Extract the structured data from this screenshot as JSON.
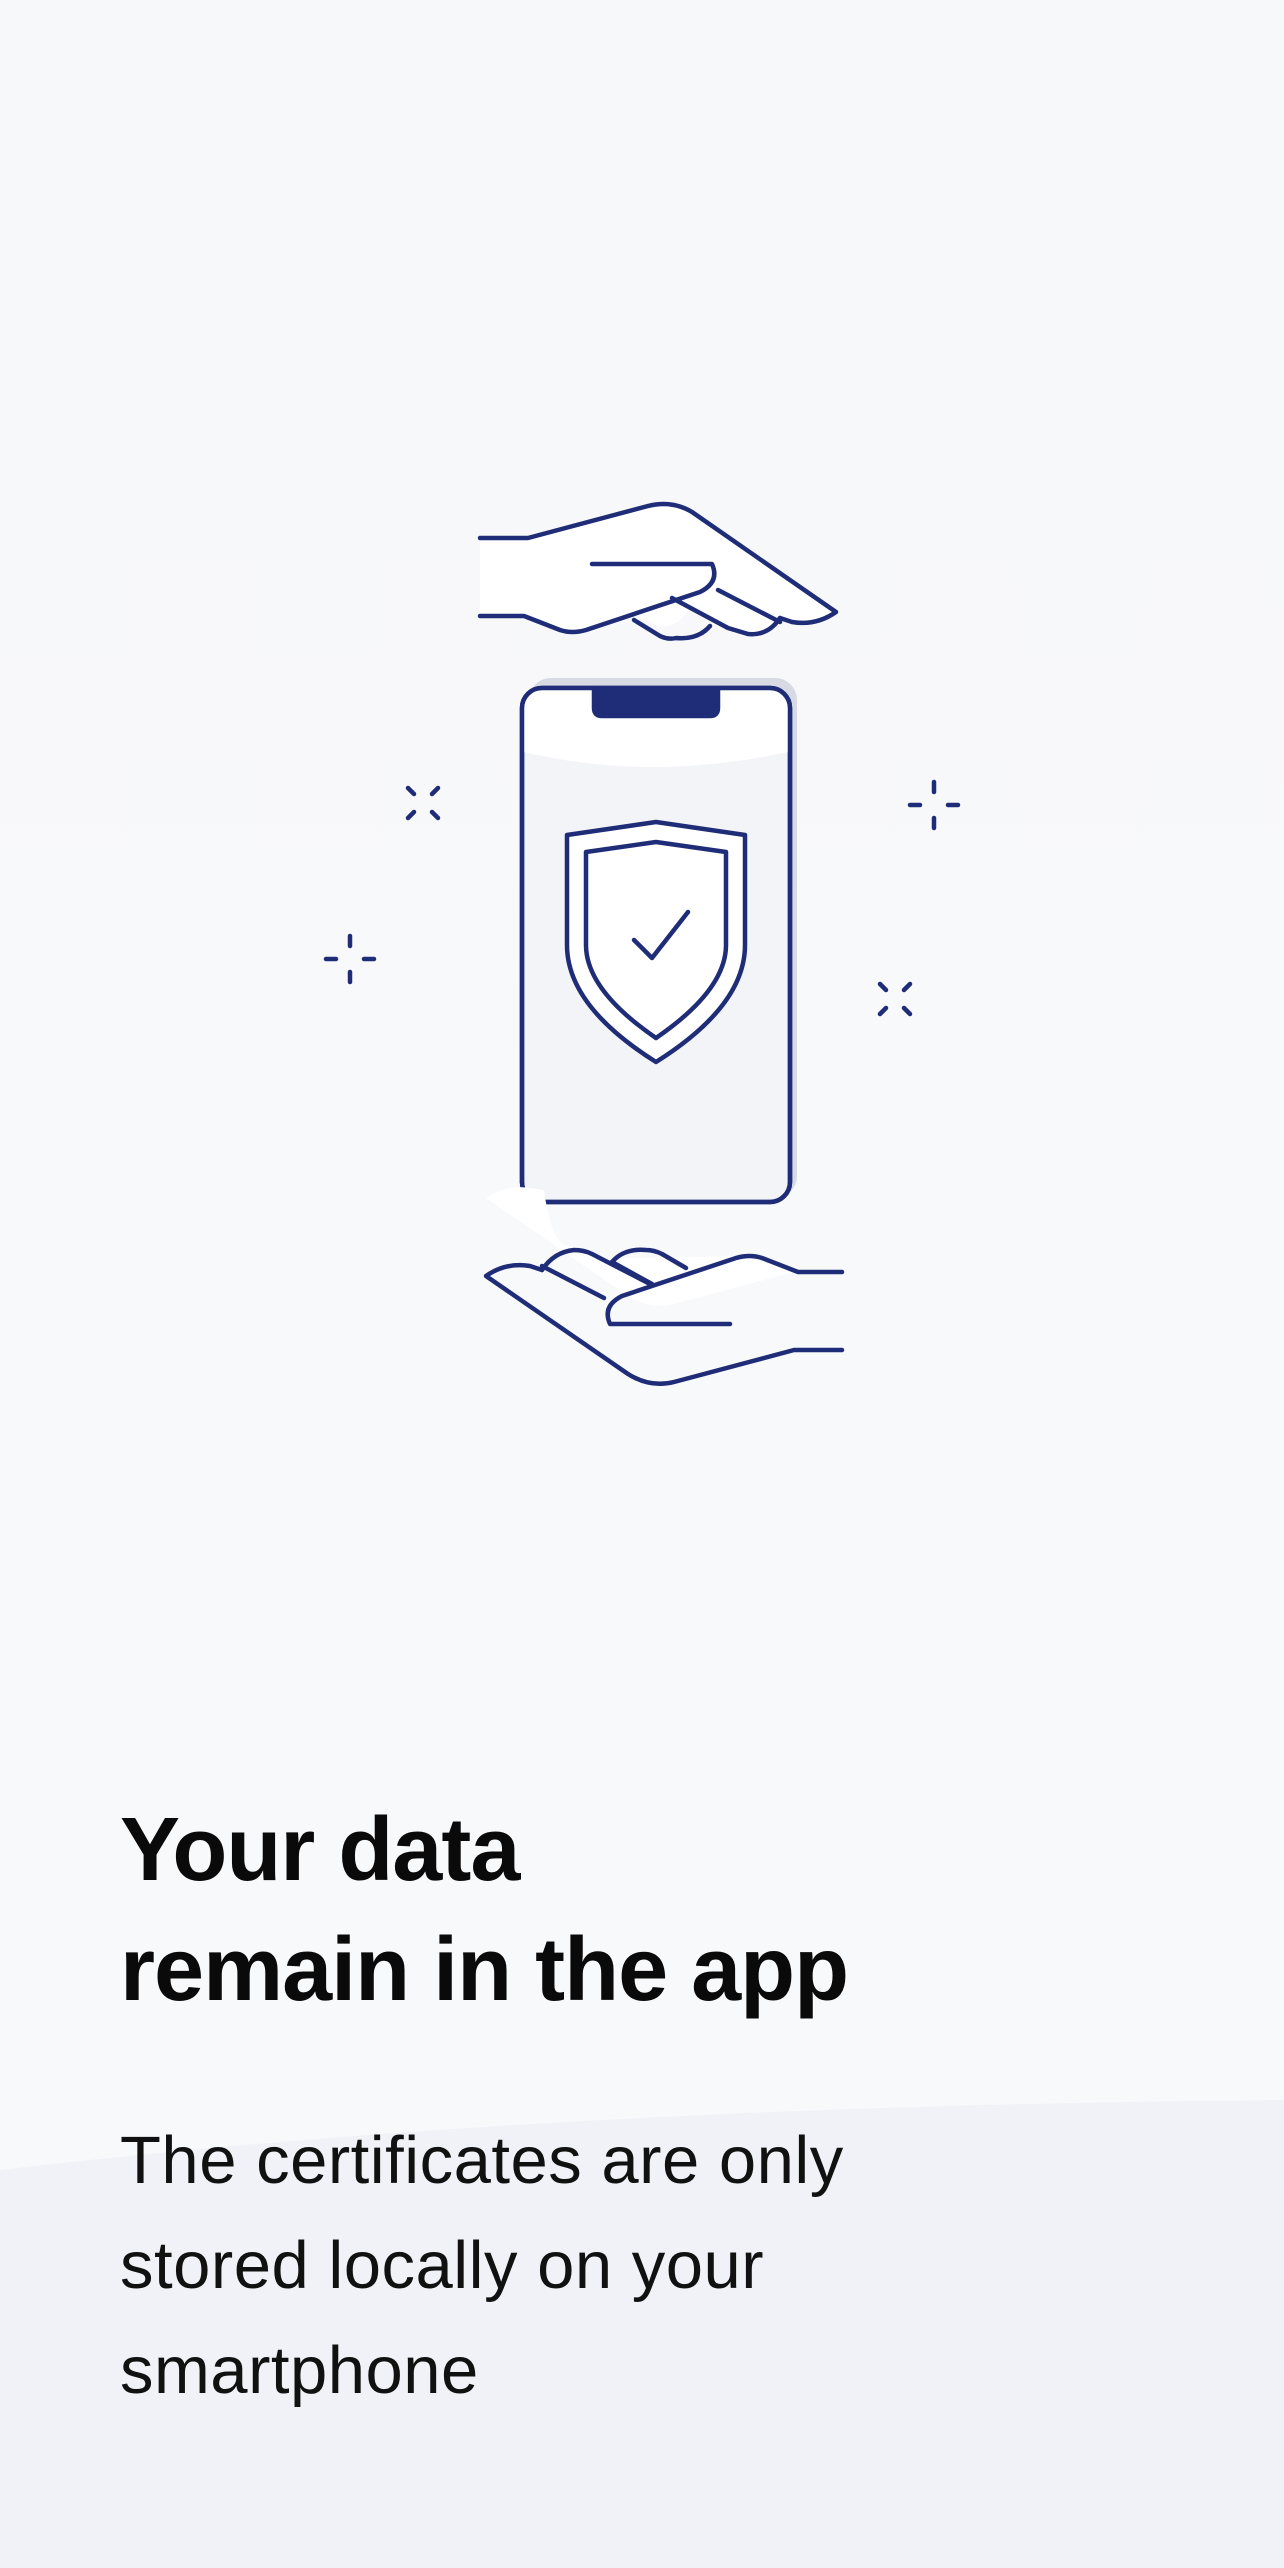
{
  "colors": {
    "accent": "#1f2d78",
    "background": "#f8f9fb",
    "screen": "#f3f4f8",
    "text": "#0a0a0a"
  },
  "illustration": {
    "icons": [
      "hand-top-icon",
      "phone-icon",
      "shield-check-icon",
      "hand-bottom-icon",
      "sparkle-icon"
    ]
  },
  "onboarding": {
    "title": "Your data\nremain in the app",
    "subtitle": "The certificates are only\nstored locally on your\nsmartphone"
  }
}
